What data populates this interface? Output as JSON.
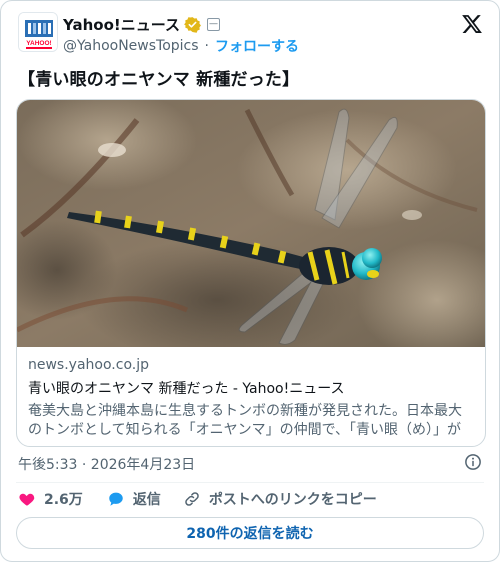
{
  "account": {
    "name": "Yahoo!ニュース",
    "handle": "@YahooNewsTopics",
    "separator": "·",
    "follow_label": "フォローする",
    "avatar_text": "YAHOO!",
    "affiliate_badge": "—"
  },
  "tweet": {
    "text": "【青い眼のオニヤンマ 新種だった】"
  },
  "link_card": {
    "domain": "news.yahoo.co.jp",
    "title": "青い眼のオニヤンマ 新種だった - Yahoo!ニュース",
    "description": "奄美大島と沖縄本島に生息するトンボの新種が発見された。日本最大のトンボとして知られる「オニヤンマ」の仲間で、「青い眼（め）」が特…"
  },
  "meta": {
    "timestamp": "午後5:33 · 2026年4月23日"
  },
  "actions": {
    "likes": "2.6万",
    "reply_label": "返信",
    "copy_link_label": "ポストへのリンクをコピー"
  },
  "read_replies_label": "280件の返信を読む",
  "colors": {
    "brand_blue": "#1d9bf0",
    "heart": "#f91880",
    "verified_gold": "#e2b719",
    "text_secondary": "#536471"
  }
}
